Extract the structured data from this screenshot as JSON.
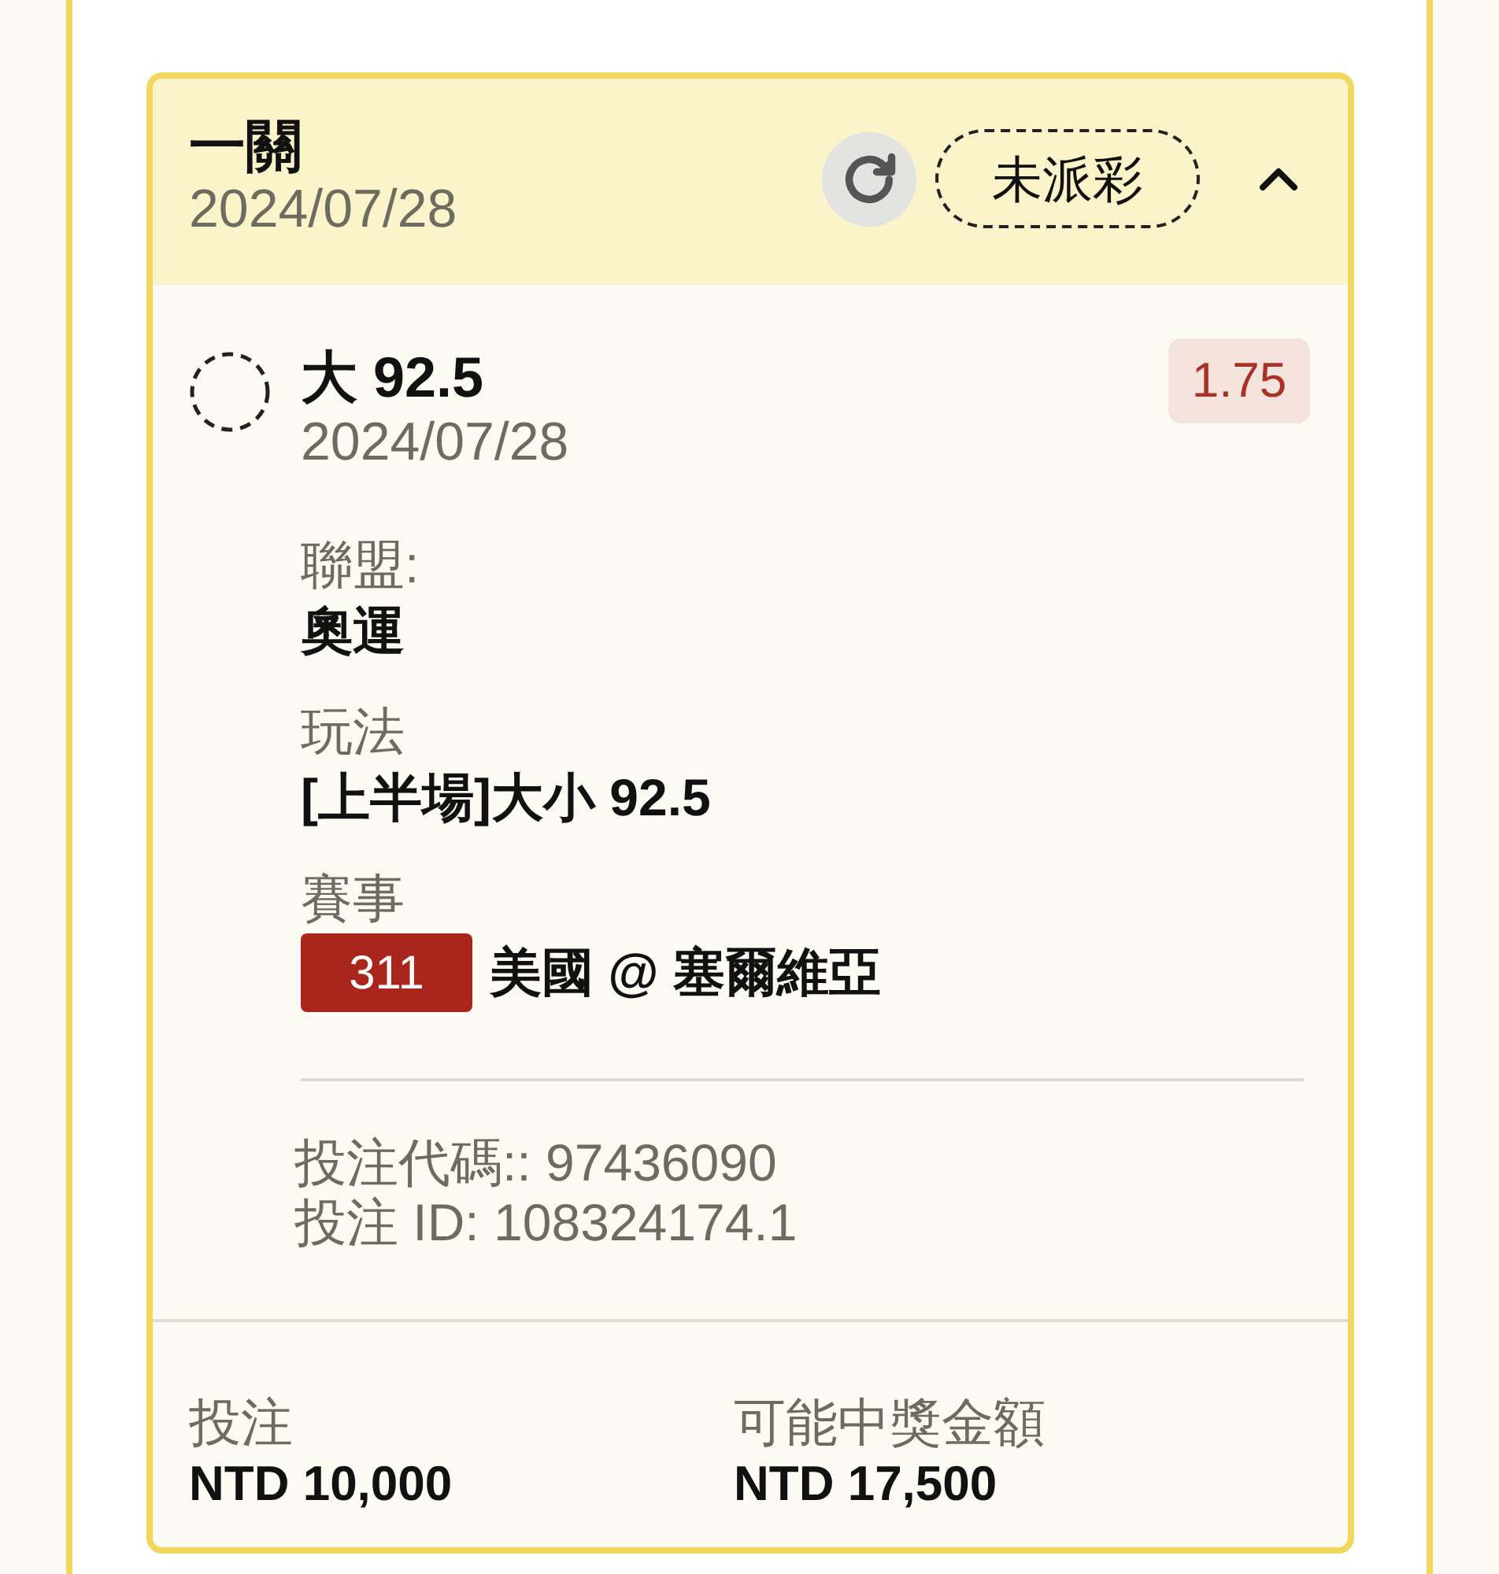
{
  "bet_card": {
    "title": "一關",
    "date": "2024/07/28",
    "status": "未派彩",
    "expanded": true
  },
  "selection": {
    "pick": "大 92.5",
    "date": "2024/07/28",
    "odds": "1.75",
    "details": [
      {
        "label": "聯盟:",
        "value": "奧運"
      },
      {
        "label": "玩法",
        "value": "[上半場]大小 92.5"
      },
      {
        "label": "賽事",
        "match_number": "311",
        "value": "美國 @ 塞爾維亞"
      }
    ],
    "bet_code": "投注代碼:: 97436090",
    "bet_id": "投注 ID: 108324174.1"
  },
  "summary": [
    {
      "label": "投注",
      "value": "NTD 10,000"
    },
    {
      "label": "可能中獎金額",
      "value": "NTD 17,500"
    }
  ]
}
